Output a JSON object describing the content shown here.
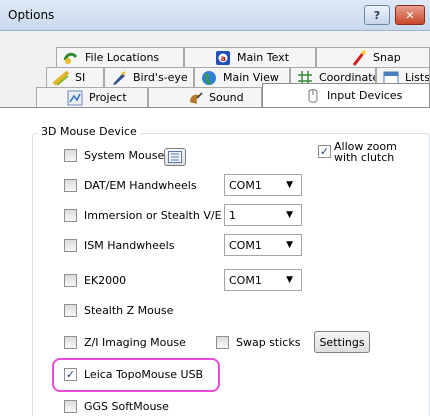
{
  "window": {
    "title": "Options"
  },
  "titlebar_buttons": {
    "help": "?",
    "close": "✕"
  },
  "tabs": [
    {
      "label": "File Locations",
      "icon": "file-locations-icon"
    },
    {
      "label": "Main Text",
      "icon": "main-text-icon"
    },
    {
      "label": "Snap",
      "icon": "snap-icon"
    },
    {
      "label": "SI",
      "icon": "si-icon"
    },
    {
      "label": "Bird's-eye",
      "icon": "birdseye-icon"
    },
    {
      "label": "Main View",
      "icon": "main-view-icon"
    },
    {
      "label": "Coordinates",
      "icon": "coordinates-icon"
    },
    {
      "label": "Lists",
      "icon": "lists-icon"
    },
    {
      "label": "Project",
      "icon": "project-icon"
    },
    {
      "label": "Sound",
      "icon": "sound-icon"
    },
    {
      "label": "Input Devices",
      "icon": "input-devices-icon",
      "active": true
    }
  ],
  "group": {
    "legend": "3D Mouse Device"
  },
  "devices": {
    "system_mouse": {
      "label": "System Mouse",
      "checked": false
    },
    "allow_zoom": {
      "label_line1": "Allow zoom",
      "label_line2": "with clutch",
      "checked": true
    },
    "dat_em": {
      "label": "DAT/EM Handwheels",
      "checked": false,
      "combo": "COM1"
    },
    "immersion": {
      "label": "Immersion or Stealth V/E",
      "checked": false,
      "combo": "1"
    },
    "ism": {
      "label": "ISM Handwheels",
      "checked": false,
      "combo": "COM1"
    },
    "ek2000": {
      "label": "EK2000",
      "checked": false,
      "combo": "COM1"
    },
    "stealth_z": {
      "label": "Stealth Z Mouse",
      "checked": false
    },
    "zi_imaging": {
      "label": "Z/I Imaging Mouse",
      "checked": false
    },
    "swap_sticks": {
      "label": "Swap sticks",
      "checked": false
    },
    "settings_button": "Settings",
    "leica": {
      "label": "Leica TopoMouse USB",
      "checked": true
    },
    "ggs": {
      "label": "GGS SoftMouse",
      "checked": false
    }
  },
  "colors": {
    "highlight": "#e84bd8",
    "title_bar": "#c9d9ec",
    "close_button": "#c7472a"
  }
}
